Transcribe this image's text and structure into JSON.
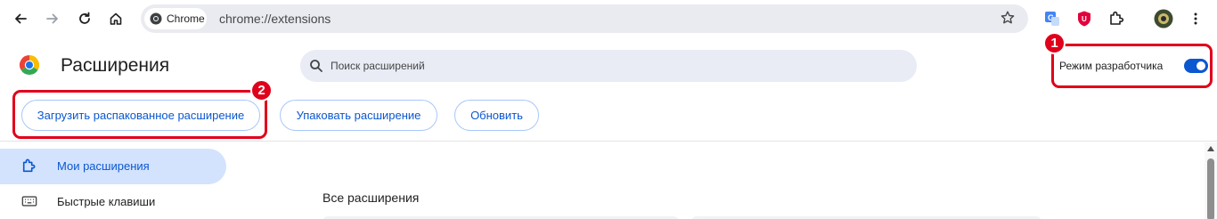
{
  "browser": {
    "back_icon": "arrow-back-icon",
    "forward_icon": "arrow-forward-icon",
    "reload_icon": "reload-icon",
    "home_icon": "home-icon",
    "site_chip_label": "Chrome",
    "url": "chrome://extensions",
    "bookmark_icon": "star-icon",
    "extension_icons": [
      "translate-icon",
      "ublock-icon",
      "extensions-puzzle-icon",
      "profile-avatar-icon",
      "kebab-menu-icon"
    ]
  },
  "header": {
    "title": "Расширения",
    "search_placeholder": "Поиск расширений",
    "developer_mode_label": "Режим разработчика",
    "developer_mode_on": true
  },
  "annotations": {
    "badge_1": "1",
    "badge_2": "2",
    "color": "#e0001b"
  },
  "toolbar_buttons": {
    "load_unpacked": "Загрузить распакованное расширение",
    "pack": "Упаковать расширение",
    "update": "Обновить"
  },
  "sidebar": {
    "items": [
      {
        "label": "Мои расширения",
        "icon": "puzzle-icon",
        "active": true
      },
      {
        "label": "Быстрые клавиши",
        "icon": "keyboard-icon",
        "active": false
      }
    ]
  },
  "main": {
    "section_title": "Все расширения"
  },
  "colors": {
    "accent": "#0b57d0",
    "active_nav_bg": "#d3e3fd",
    "omnibox_bg": "#e9ebf0"
  }
}
